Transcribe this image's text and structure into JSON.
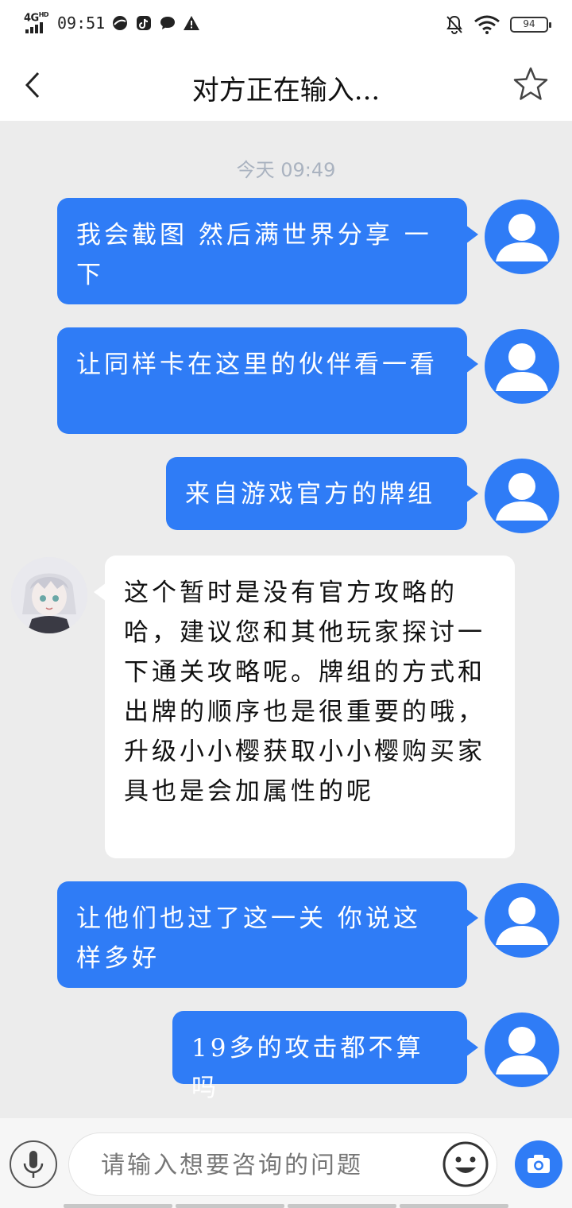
{
  "status_bar": {
    "network": "4G",
    "network_sup": "HD",
    "time": "09:51",
    "battery": "94"
  },
  "header": {
    "title": "对方正在输入..."
  },
  "chat": {
    "timestamp": "今天 09:49",
    "messages": [
      {
        "sender": "user",
        "text": "我会截图 然后满世界分享 一下"
      },
      {
        "sender": "user",
        "text": "让同样卡在这里的伙伴看一看"
      },
      {
        "sender": "user",
        "text": "来自游戏官方的牌组"
      },
      {
        "sender": "agent",
        "text": "这个暂时是没有官方攻略的哈，建议您和其他玩家探讨一下通关攻略呢。牌组的方式和出牌的顺序也是很重要的哦，升级小小樱获取小小樱购买家具也是会加属性的呢"
      },
      {
        "sender": "user",
        "text": "让他们也过了这一关 你说这样多好"
      },
      {
        "sender": "user",
        "text": "19多的攻击都不算吗"
      }
    ]
  },
  "input": {
    "placeholder": "请输入想要咨询的问题"
  },
  "colors": {
    "accent": "#2f7cf6",
    "chat_bg": "#ececec",
    "timestamp": "#aab3c0"
  },
  "icons": {
    "back": "chevron-left-icon",
    "favorite": "star-outline-icon",
    "mic": "microphone-icon",
    "emoji": "smiley-icon",
    "camera": "camera-icon"
  }
}
